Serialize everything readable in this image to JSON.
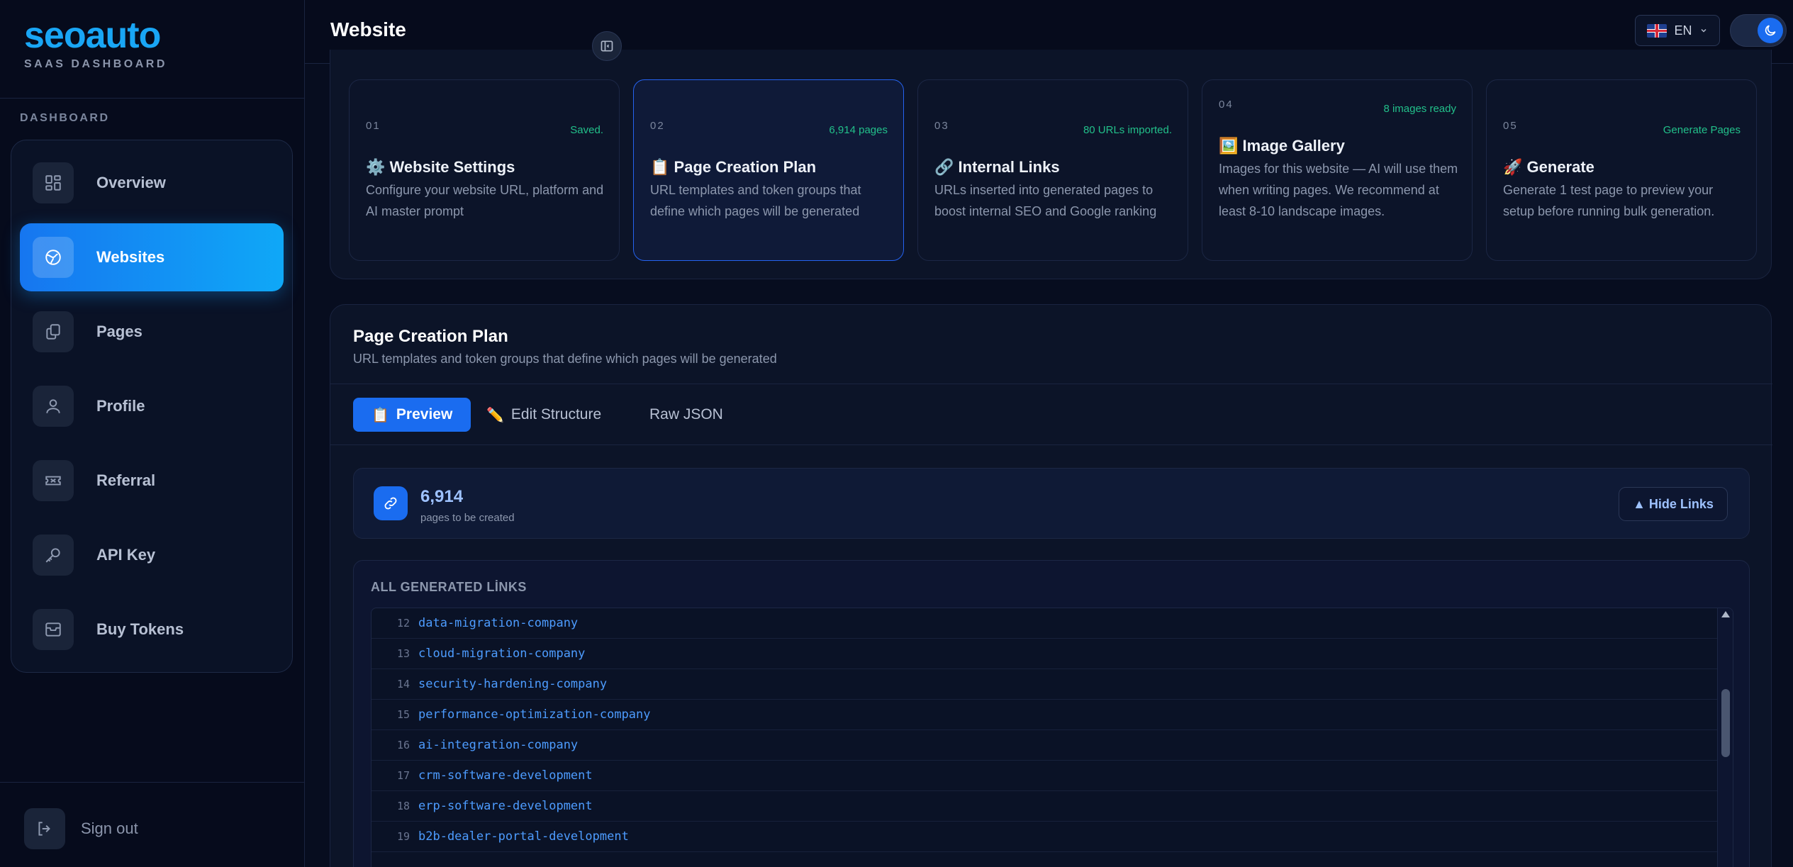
{
  "brand": {
    "logo": "seoauto",
    "subtitle": "SAAS DASHBOARD"
  },
  "sidebar": {
    "section_label": "DASHBOARD",
    "items": [
      {
        "label": "Overview",
        "icon": "grid-icon"
      },
      {
        "label": "Websites",
        "icon": "globe-icon",
        "active": true
      },
      {
        "label": "Pages",
        "icon": "copy-icon"
      },
      {
        "label": "Profile",
        "icon": "user-icon"
      },
      {
        "label": "Referral",
        "icon": "ticket-icon"
      },
      {
        "label": "API Key",
        "icon": "key-icon"
      },
      {
        "label": "Buy Tokens",
        "icon": "archive-icon"
      }
    ],
    "signout_label": "Sign out"
  },
  "header": {
    "title": "Website",
    "language": "EN",
    "theme": "dark"
  },
  "steps": [
    {
      "num": "01",
      "badge": "Saved.",
      "glyph": "⚙️",
      "title": "Website Settings",
      "desc": "Configure your website URL, platform and AI master prompt"
    },
    {
      "num": "02",
      "badge": "6,914 pages",
      "glyph": "📋",
      "title": "Page Creation Plan",
      "desc": "URL templates and token groups that define which pages will be generated",
      "active": true
    },
    {
      "num": "03",
      "badge": "80 URLs imported.",
      "glyph": "🔗",
      "title": "Internal Links",
      "desc": "URLs inserted into generated pages to boost internal SEO and Google ranking"
    },
    {
      "num": "04",
      "badge": "8 images ready",
      "glyph": "🖼️",
      "title": "Image Gallery",
      "desc": "Images for this website — AI will use them when writing pages. We recommend at least 8-10 landscape images."
    },
    {
      "num": "05",
      "badge": "Generate Pages",
      "glyph": "🚀",
      "title": "Generate",
      "desc": "Generate 1 test page to preview your setup before running bulk generation."
    }
  ],
  "plan": {
    "title": "Page Creation Plan",
    "subtitle": "URL templates and token groups that define which pages will be generated",
    "tabs": [
      {
        "glyph": "📋",
        "label": "Preview",
        "active": true
      },
      {
        "glyph": "✏️",
        "label": "Edit Structure"
      },
      {
        "glyph": "",
        "label": "Raw JSON"
      }
    ],
    "count_value": "6,914",
    "count_label": "pages to be created",
    "hide_links_label": "▲ Hide Links",
    "links_header": "ALL GENERATED LİNKS",
    "links": [
      {
        "num": "12",
        "text": "data-migration-company"
      },
      {
        "num": "13",
        "text": "cloud-migration-company"
      },
      {
        "num": "14",
        "text": "security-hardening-company"
      },
      {
        "num": "15",
        "text": "performance-optimization-company"
      },
      {
        "num": "16",
        "text": "ai-integration-company"
      },
      {
        "num": "17",
        "text": "crm-software-development"
      },
      {
        "num": "18",
        "text": "erp-software-development"
      },
      {
        "num": "19",
        "text": "b2b-dealer-portal-development"
      }
    ]
  },
  "colors": {
    "accent": "#1a6cf0",
    "brand": "#19a6f5",
    "success": "#22c08a",
    "link": "#4d9cff"
  }
}
